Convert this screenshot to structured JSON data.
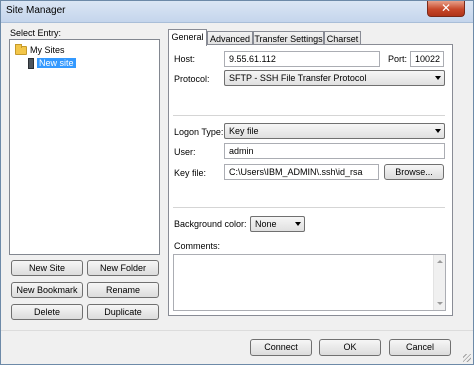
{
  "window": {
    "title": "Site Manager",
    "close_glyph": "✕"
  },
  "left": {
    "select_entry_label": "Select Entry:",
    "tree": [
      {
        "label": "My Sites",
        "icon": "folder-icon"
      },
      {
        "label": "New site",
        "icon": "site-icon",
        "selected": true
      }
    ],
    "buttons": {
      "new_site": "New Site",
      "new_folder": "New Folder",
      "new_bookmark": "New Bookmark",
      "rename": "Rename",
      "delete": "Delete",
      "duplicate": "Duplicate"
    }
  },
  "tabs": [
    {
      "label": "General",
      "active": true
    },
    {
      "label": "Advanced"
    },
    {
      "label": "Transfer Settings"
    },
    {
      "label": "Charset"
    }
  ],
  "general": {
    "host_label": "Host:",
    "host_value": "9.55.61.112",
    "port_label": "Port:",
    "port_value": "10022",
    "protocol_label": "Protocol:",
    "protocol_value": "SFTP - SSH File Transfer Protocol",
    "logon_type_label": "Logon Type:",
    "logon_type_value": "Key file",
    "user_label": "User:",
    "user_value": "admin",
    "key_file_label": "Key file:",
    "key_file_value": "C:\\Users\\IBM_ADMIN\\.ssh\\id_rsa",
    "browse_label": "Browse...",
    "background_color_label": "Background color:",
    "background_color_value": "None",
    "comments_label": "Comments:"
  },
  "footer": {
    "connect": "Connect",
    "ok": "OK",
    "cancel": "Cancel"
  },
  "colors": {
    "selection": "#3399ff",
    "close_button": "#c7482a"
  }
}
